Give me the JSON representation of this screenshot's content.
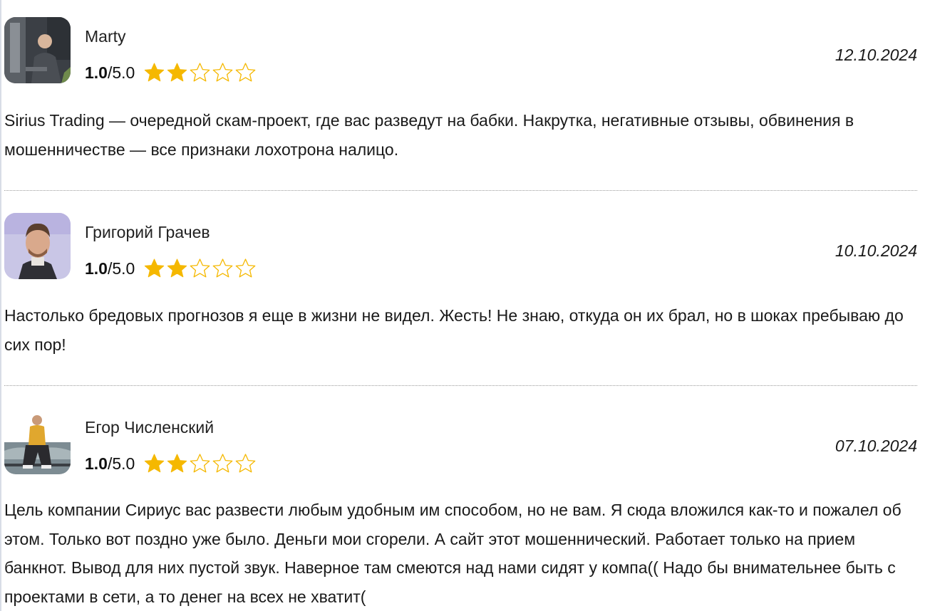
{
  "reviews": [
    {
      "author": "Marty",
      "score": "1.0",
      "max": "/5.0",
      "stars_filled": 2,
      "stars_total": 5,
      "date": "12.10.2024",
      "text": "Sirius Trading — очередной скам-проект, где вас разведут на бабки. Накрутка, негативные отзывы, обвинения в мошенничестве — все признаки лохотрона налицо."
    },
    {
      "author": "Григорий Грачев",
      "score": "1.0",
      "max": "/5.0",
      "stars_filled": 2,
      "stars_total": 5,
      "date": "10.10.2024",
      "text": "Настолько бредовых прогнозов я еще в жизни не видел. Жесть! Не знаю, откуда он их брал, но в шоках пребываю до сих пор!"
    },
    {
      "author": "Егор Численский",
      "score": "1.0",
      "max": "/5.0",
      "stars_filled": 2,
      "stars_total": 5,
      "date": "07.10.2024",
      "text": "Цель компании Сириус вас развести любым удобным им способом, но не вам. Я сюда вложился как-то и пожалел об этом. Только вот поздно уже было. Деньги мои сгорели. А сайт этот мошеннический. Работает только на прием банкнот. Вывод для них пустой звук. Наверное там смеются над нами сидят у компа(( Надо бы внимательнее быть с проектами в сети, а то денег на всех не хватит("
    }
  ],
  "colors": {
    "star": "#f5b800",
    "divider": "#9a9a9a",
    "text": "#1a1a1a"
  },
  "icons": {
    "filled_star": "star-filled-icon",
    "empty_star": "star-outline-icon"
  }
}
